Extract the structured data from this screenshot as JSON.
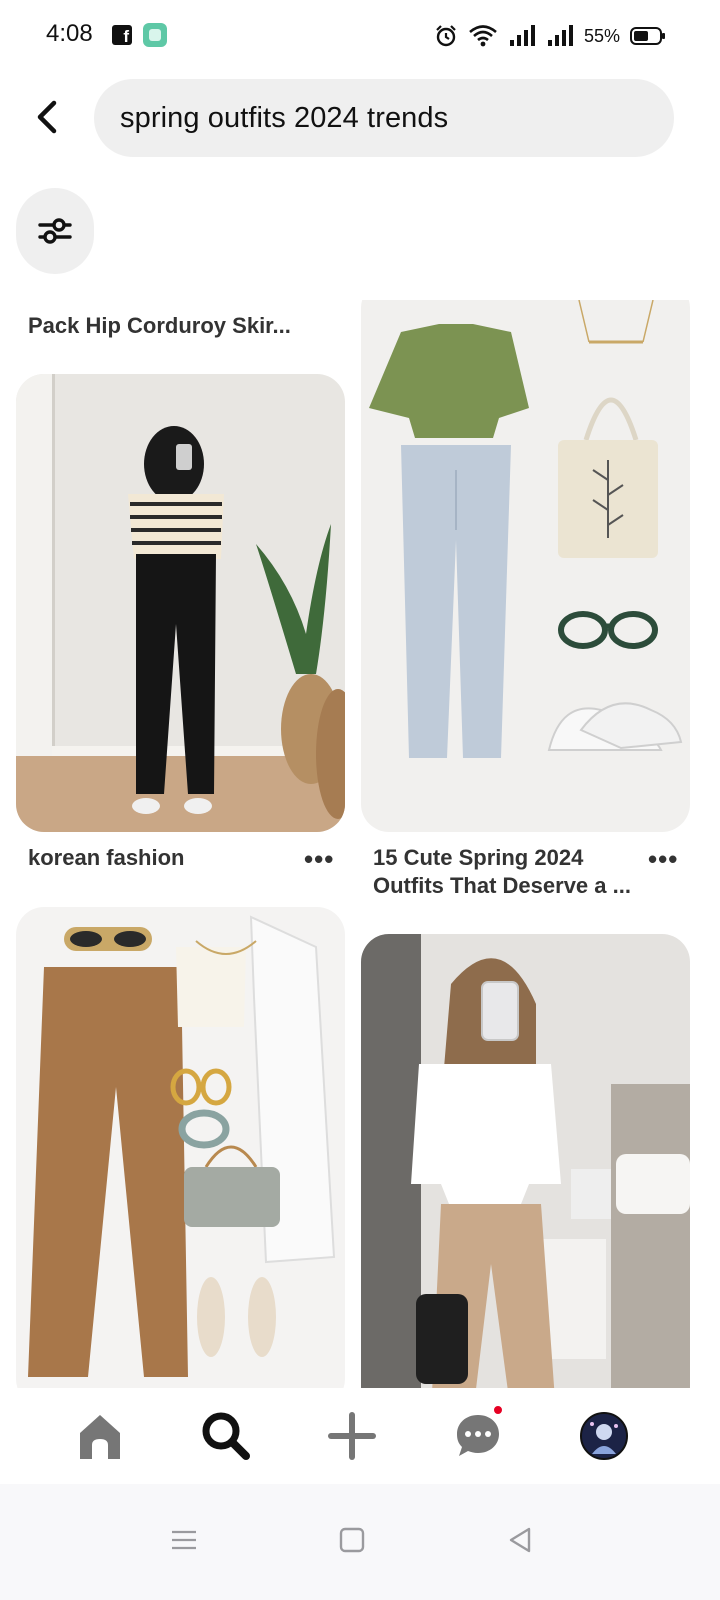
{
  "status_bar": {
    "time": "4:08",
    "battery": "55%"
  },
  "search": {
    "query": "spring outfits 2024 trends"
  },
  "pins": [
    {
      "title": "Pack Hip Corduroy Skir..."
    },
    {
      "title": "korean fashion",
      "more": "•••"
    },
    {
      "title_line1": "15 Cute Spring 2024",
      "title_line2": "Outfits That Deserve a ...",
      "more": "•••"
    }
  ],
  "colors": {
    "accent": "#e60023",
    "search_bg": "#efefef",
    "nav_icon": "#767676"
  },
  "nav": {
    "items": [
      "home-icon",
      "search-icon",
      "create-icon",
      "messages-icon",
      "profile-avatar"
    ],
    "active": "search-icon"
  }
}
